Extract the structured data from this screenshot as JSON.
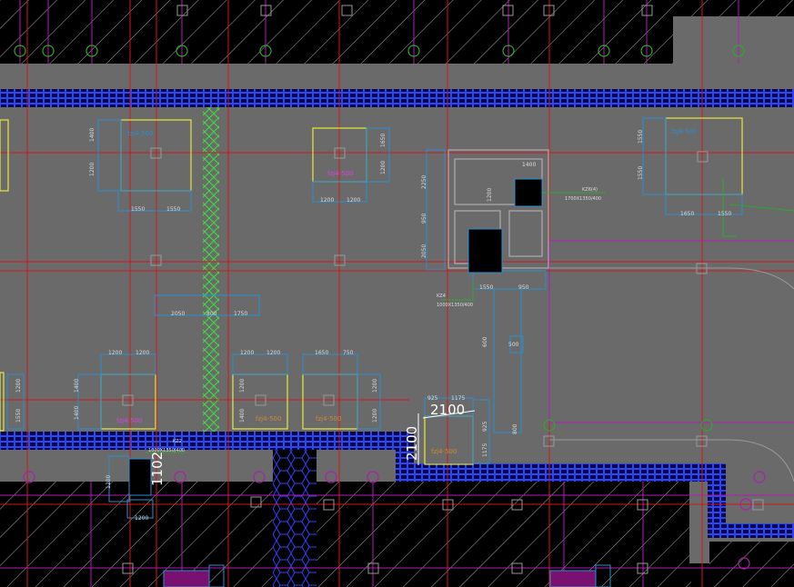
{
  "colors": {
    "background": "#000000",
    "slab": "#6a6a6a",
    "grid_red": "#d01818",
    "grid_magenta": "#b01cb0",
    "footing_yellow": "#e8e83a",
    "dim_blue": "#2a8fd0",
    "brick_blue": "#1a2ee0",
    "green_hatch": "#38e038",
    "hatch_white": "#d8d8d8",
    "column_green": "#2ea82e"
  },
  "dimensions": {
    "big_width": "2100",
    "big_height": "2100",
    "side_label": "1102",
    "d1": "1400",
    "d2": "1550",
    "d3": "1200",
    "d4": "2050",
    "d5": "800",
    "d6": "1750",
    "d7": "1650",
    "d8": "750",
    "d9": "925",
    "d10": "1175",
    "d11": "2250",
    "d12": "950",
    "d13": "1550",
    "d14": "600",
    "d15": "500"
  },
  "footing_tags": {
    "t1": "fzj4-500",
    "t2": "fzj4-500",
    "t3": "fzj4-500",
    "t4": "fzj4-500",
    "t5": "fzj4-500",
    "t6": "fzj4-500",
    "t7": "fzj4-500"
  },
  "notes": {
    "n1": "KZ6(4)",
    "n2": "1700X1350/400",
    "n3": "KZ4",
    "n4": "1000X1350/400",
    "n5": "KZ2",
    "n6": "1000X1350/400"
  }
}
